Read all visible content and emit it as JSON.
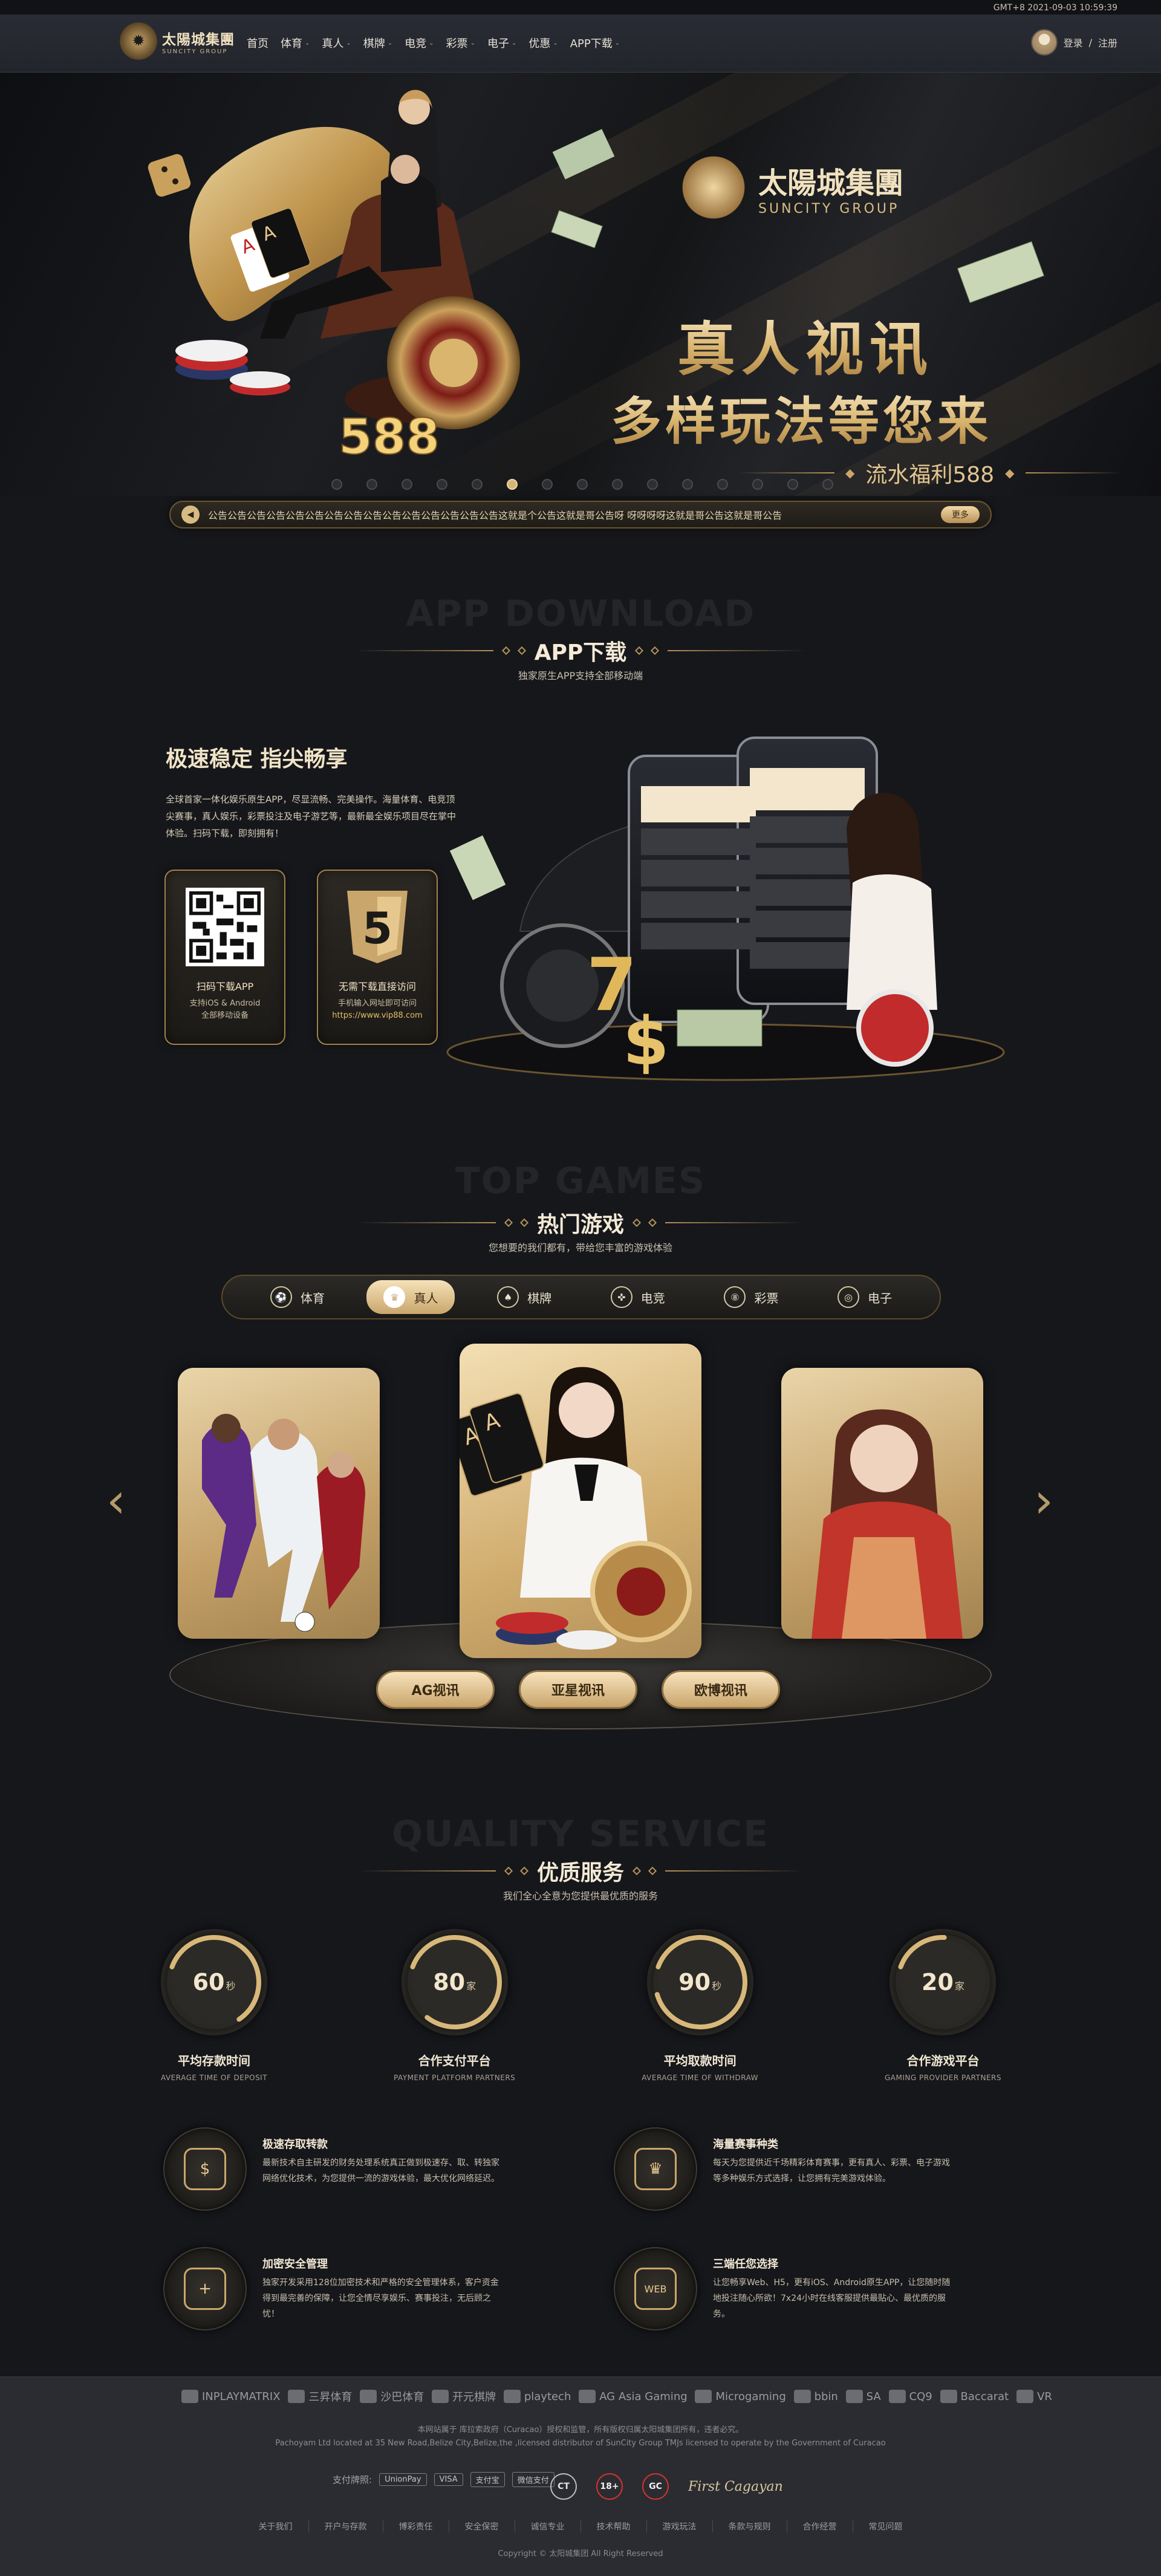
{
  "topbar": {
    "clock": "GMT+8 2021-09-03 10:59:39"
  },
  "brand": {
    "cn": "太陽城集團",
    "en": "SUNCITY GROUP"
  },
  "nav": {
    "items": [
      {
        "label": "首页",
        "caret": false
      },
      {
        "label": "体育",
        "caret": true
      },
      {
        "label": "真人",
        "caret": true
      },
      {
        "label": "棋牌",
        "caret": true
      },
      {
        "label": "电竞",
        "caret": true
      },
      {
        "label": "彩票",
        "caret": true
      },
      {
        "label": "电子",
        "caret": true
      },
      {
        "label": "优惠",
        "caret": true
      },
      {
        "label": "APP下载",
        "caret": true
      }
    ],
    "login": "登录",
    "sep": "/",
    "register": "注册"
  },
  "hero": {
    "brand_cn": "太陽城集團",
    "brand_en": "SUNCITY GROUP",
    "title1": "真人视讯",
    "title2": "多样玩法等您来",
    "promo": "流水福利588",
    "chips": "588",
    "slides": 15,
    "active_slide": 5
  },
  "notice": {
    "text": "公告公告公告公告公告公告公告公告公告公告公告公告公告公告公告这就是个公告这就是哥公告呀 呀呀呀呀这就是哥公告这就是哥公告",
    "more": "更多"
  },
  "app": {
    "ghost": "APP DOWNLOAD",
    "title": "APP下载",
    "subtitle": "独家原生APP支持全部移动端",
    "headline": "极速稳定 指尖畅享",
    "desc": "全球首家一体化娱乐原生APP，尽显流畅、完美操作。海量体育、电竞顶尖赛事，真人娱乐，彩票投注及电子游艺等，最新最全娱乐项目尽在掌中体验。扫码下载，即刻拥有！",
    "qr": {
      "title": "扫码下载APP",
      "line1": "支持iOS & Android",
      "line2": "全部移动设备"
    },
    "h5": {
      "title": "无需下载直接访问",
      "line1": "手机输入网址即可访问",
      "url": "https://www.vip88.com"
    }
  },
  "games": {
    "ghost": "TOP GAMES",
    "title": "热门游戏",
    "subtitle": "您想要的我们都有，带给您丰富的游戏体验",
    "tabs": [
      {
        "label": "体育",
        "icon": "soccer-ball-icon",
        "glyph": "⚽",
        "active": false
      },
      {
        "label": "真人",
        "icon": "poker-chip-icon",
        "glyph": "♛",
        "active": true
      },
      {
        "label": "棋牌",
        "icon": "spade-icon",
        "glyph": "♠",
        "active": false
      },
      {
        "label": "电竞",
        "icon": "gamepad-icon",
        "glyph": "✜",
        "active": false
      },
      {
        "label": "彩票",
        "icon": "lottery-icon",
        "glyph": "⑧",
        "active": false
      },
      {
        "label": "电子",
        "icon": "slot-icon",
        "glyph": "◎",
        "active": false
      }
    ],
    "providers": [
      "AG视讯",
      "亚星视讯",
      "欧博视讯"
    ]
  },
  "quality": {
    "ghost": "QUALITY SERVICE",
    "title": "优质服务",
    "subtitle": "我们全心全意为您提供最优质的服务",
    "stats": [
      {
        "num": "60",
        "unit": "秒",
        "label": "平均存款时间",
        "en": "AVERAGE TIME OF DEPOSIT",
        "progress": 0.6
      },
      {
        "num": "80",
        "unit": "家",
        "label": "合作支付平台",
        "en": "PAYMENT PLATFORM PARTNERS",
        "progress": 0.8
      },
      {
        "num": "90",
        "unit": "秒",
        "label": "平均取款时间",
        "en": "AVERAGE TIME OF WITHDRAW",
        "progress": 0.9
      },
      {
        "num": "20",
        "unit": "家",
        "label": "合作游戏平台",
        "en": "GAMING PROVIDER PARTNERS",
        "progress": 0.2
      }
    ],
    "features": [
      {
        "title": "极速存取转款",
        "desc": "最新技术自主研发的财务处理系统真正做到极速存、取、转独家网络优化技术，为您提供一流的游戏体验，最大优化网络延迟。",
        "icon": "money-bag-icon",
        "glyph": "$"
      },
      {
        "title": "海量赛事种类",
        "desc": "每天为您提供近千场精彩体育赛事，更有真人、彩票、电子游戏等多种娱乐方式选择，让您拥有完美游戏体验。",
        "icon": "trophy-icon",
        "glyph": "♛"
      },
      {
        "title": "加密安全管理",
        "desc": "独家开发采用128位加密技术和严格的安全管理体系，客户资金得到最完善的保障，让您全情尽享娱乐、赛事投注，无后顾之忧！",
        "icon": "shield-icon",
        "glyph": "+"
      },
      {
        "title": "三端任您选择",
        "desc": "让您畅享Web、H5，更有iOS、Android原生APP，让您随时随地投注随心所欲！7x24小时在线客服提供最贴心、最优质的服务。",
        "icon": "web-icon",
        "glyph": "WEB"
      }
    ]
  },
  "footer": {
    "partners": [
      "INPLAYMATRIX",
      "三昇体育",
      "沙巴体育",
      "开元棋牌",
      "playtech",
      "AG Asia Gaming",
      "Microgaming",
      "bbin",
      "SA",
      "CQ9",
      "Baccarat",
      "VR"
    ],
    "legal1": "本网站属于 库拉索政府（Curacao）授权和监管，所有版权归属太阳城集团所有，违者必究。",
    "legal2": "Pachoyam Ltd located at 35 New Road,Belize City,Belize,the ,licensed distributor of SunCity Group TMJs licensed to operate by the Government of Curacao",
    "pay_label": "支付牌照:",
    "pay": [
      "UnionPay",
      "VISA",
      "支付宝",
      "微信支付"
    ],
    "certs": [
      "CT",
      "18+",
      "GC"
    ],
    "signature": "First Cagayan",
    "links": [
      "关于我们",
      "开户与存款",
      "博彩责任",
      "安全保密",
      "诚信专业",
      "技术帮助",
      "游戏玩法",
      "条款与规则",
      "合作经营",
      "常见问题"
    ],
    "copyright": "Copyright © 太阳城集团 All Right Reserved"
  },
  "colors": {
    "gold": "#e8c98e",
    "bg": "#16171b",
    "nav": "#2a2c35"
  }
}
